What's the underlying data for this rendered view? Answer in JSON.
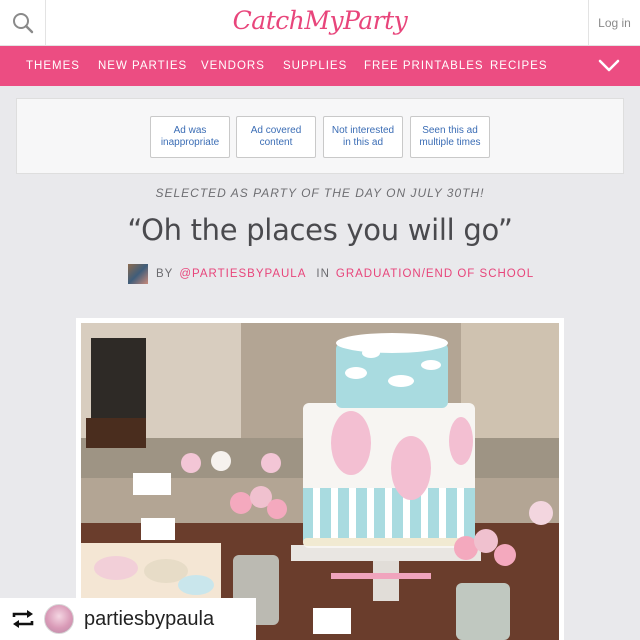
{
  "header": {
    "logo_text": "CatchMyParty",
    "login_label": "Log in",
    "search_icon": "search-icon"
  },
  "nav": {
    "items": [
      "THEMES",
      "NEW PARTIES",
      "VENDORS",
      "SUPPLIES",
      "FREE PRINTABLES",
      "RECIPES"
    ],
    "menu_icon": "chevron-down-icon",
    "color": "#ec4d82"
  },
  "ad_feedback": {
    "buttons": [
      "Ad was inappropriate",
      "Ad covered content",
      "Not interested in this ad",
      "Seen this ad multiple times"
    ]
  },
  "party": {
    "selected_note": "SELECTED AS PARTY OF THE DAY ON JULY 30TH!",
    "title": "“Oh the places you will go”",
    "by_label": "BY",
    "author": "@PARTIESBYPAULA",
    "in_label": "IN",
    "category": "GRADUATION/END OF SCHOOL"
  },
  "repost": {
    "icon": "repost-icon",
    "username": "partiesbypaula"
  },
  "colors": {
    "brand_pink": "#e8457b",
    "background": "#e9e9ec",
    "cake_blue": "#a9dbe0"
  }
}
